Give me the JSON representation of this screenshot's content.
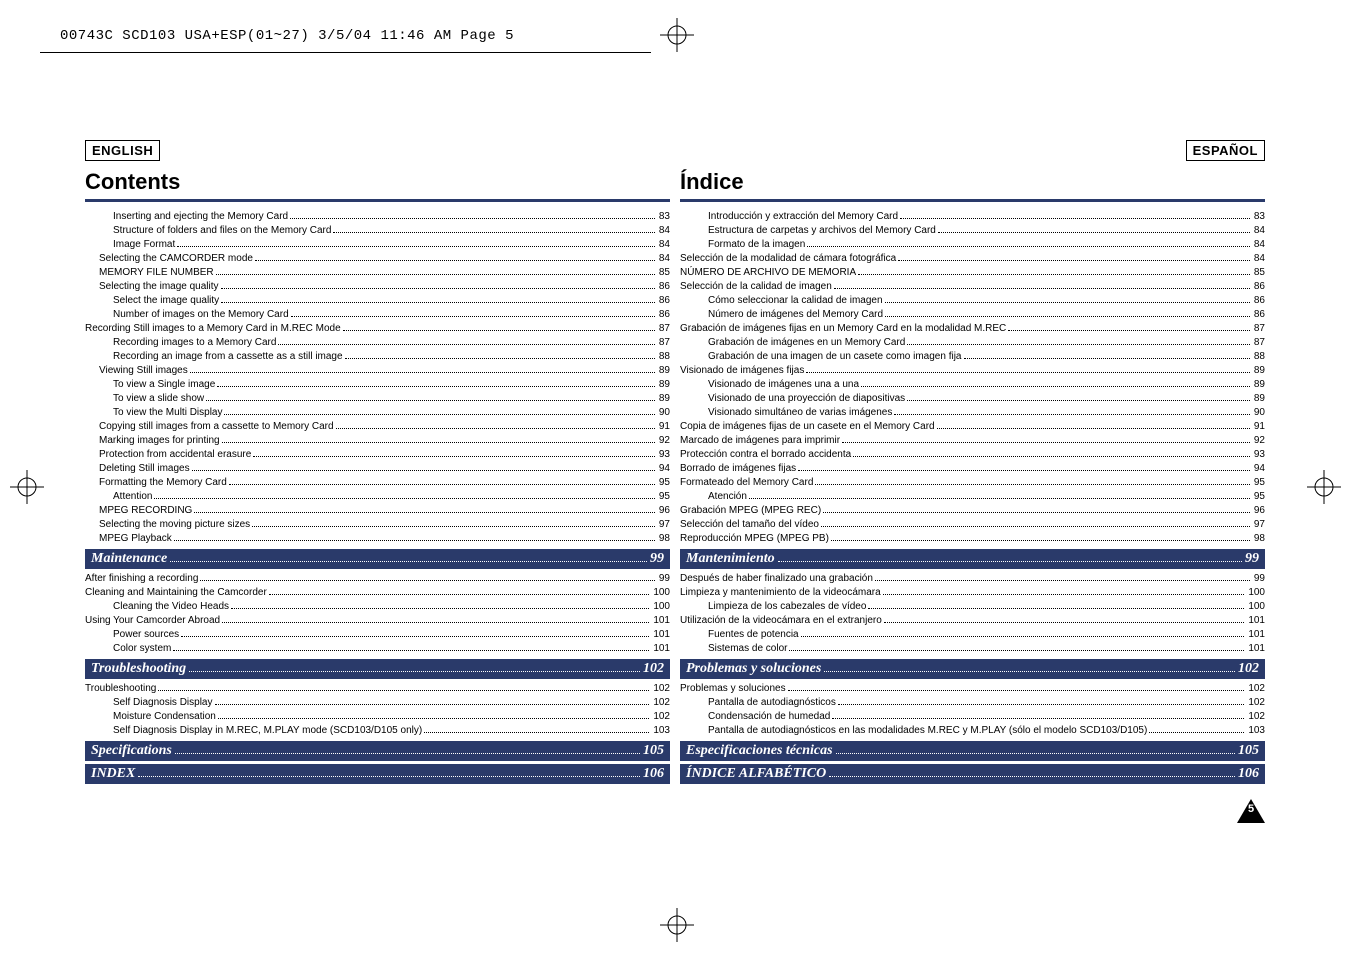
{
  "header_info": "00743C SCD103 USA+ESP(01~27)  3/5/04 11:46 AM  Page 5",
  "page_number": "5",
  "left": {
    "lang": "ENGLISH",
    "heading": "Contents",
    "entries": [
      {
        "l": "Inserting and ejecting the Memory Card",
        "p": "83",
        "i": 2
      },
      {
        "l": "Structure of folders and files on the Memory Card",
        "p": "84",
        "i": 2
      },
      {
        "l": "Image Format",
        "p": "84",
        "i": 2
      },
      {
        "l": "Selecting the CAMCORDER mode",
        "p": "84",
        "i": 1
      },
      {
        "l": "MEMORY FILE NUMBER",
        "p": "85",
        "i": 1
      },
      {
        "l": "Selecting the image quality",
        "p": "86",
        "i": 1
      },
      {
        "l": "Select the image quality",
        "p": "86",
        "i": 2
      },
      {
        "l": "Number of images on the Memory Card",
        "p": "86",
        "i": 2
      },
      {
        "l": "Recording Still images to a Memory Card in M.REC Mode",
        "p": "87",
        "i": 0
      },
      {
        "l": "Recording images to a Memory Card",
        "p": "87",
        "i": 2
      },
      {
        "l": "Recording an image from a cassette as a still image",
        "p": "88",
        "i": 2
      },
      {
        "l": "Viewing Still images",
        "p": "89",
        "i": 1
      },
      {
        "l": "To view a Single image",
        "p": "89",
        "i": 2
      },
      {
        "l": "To view a slide show",
        "p": "89",
        "i": 2
      },
      {
        "l": "To view the Multi Display",
        "p": "90",
        "i": 2
      },
      {
        "l": "Copying still images from a cassette to Memory Card",
        "p": "91",
        "i": 1
      },
      {
        "l": "Marking images for printing",
        "p": "92",
        "i": 1
      },
      {
        "l": "Protection from accidental erasure",
        "p": "93",
        "i": 1
      },
      {
        "l": "Deleting Still images",
        "p": "94",
        "i": 1
      },
      {
        "l": "Formatting the Memory Card",
        "p": "95",
        "i": 1
      },
      {
        "l": "Attention",
        "p": "95",
        "i": 2
      },
      {
        "l": "MPEG RECORDING",
        "p": "96",
        "i": 1
      },
      {
        "l": "Selecting the moving picture sizes",
        "p": "97",
        "i": 1
      },
      {
        "l": "MPEG Playback",
        "p": "98",
        "i": 1
      }
    ],
    "sections": [
      {
        "title": "Maintenance",
        "p": "99",
        "entries": [
          {
            "l": "After finishing a recording",
            "p": "99",
            "i": 0
          },
          {
            "l": "Cleaning and Maintaining the Camcorder",
            "p": "100",
            "i": 0
          },
          {
            "l": "Cleaning the Video Heads",
            "p": "100",
            "i": 2
          },
          {
            "l": "Using Your Camcorder Abroad",
            "p": "101",
            "i": 0
          },
          {
            "l": "Power sources",
            "p": "101",
            "i": 2
          },
          {
            "l": "Color system",
            "p": "101",
            "i": 2
          }
        ]
      },
      {
        "title": "Troubleshooting",
        "p": "102",
        "entries": [
          {
            "l": "Troubleshooting",
            "p": "102",
            "i": 0
          },
          {
            "l": "Self Diagnosis Display",
            "p": "102",
            "i": 2
          },
          {
            "l": "Moisture Condensation",
            "p": "102",
            "i": 2
          },
          {
            "l": "Self Diagnosis Display in M.REC, M.PLAY mode (SCD103/D105 only)",
            "p": "103",
            "i": 2
          }
        ]
      },
      {
        "title": "Specifications",
        "p": "105",
        "entries": []
      },
      {
        "title": "INDEX",
        "p": "106",
        "entries": []
      }
    ]
  },
  "right": {
    "lang": "ESPAÑOL",
    "heading": "Índice",
    "entries": [
      {
        "l": "Introducción y extracción del Memory Card",
        "p": "83",
        "i": 2
      },
      {
        "l": "Estructura de carpetas y archivos del Memory Card",
        "p": "84",
        "i": 2
      },
      {
        "l": "Formato de la imagen",
        "p": "84",
        "i": 2
      },
      {
        "l": "Selección de la modalidad de cámara fotográfica",
        "p": "84",
        "i": 0
      },
      {
        "l": "NÚMERO DE ARCHIVO DE MEMORIA",
        "p": "85",
        "i": 0
      },
      {
        "l": "Selección de la calidad de imagen",
        "p": "86",
        "i": 0
      },
      {
        "l": "Cómo seleccionar la calidad de imagen",
        "p": "86",
        "i": 2
      },
      {
        "l": "Número de imágenes del Memory Card",
        "p": "86",
        "i": 2
      },
      {
        "l": "Grabación de imágenes fijas en un Memory Card en la modalidad M.REC",
        "p": "87",
        "i": 0
      },
      {
        "l": "Grabación de imágenes en un Memory Card",
        "p": "87",
        "i": 2
      },
      {
        "l": "Grabación de una imagen de un casete como imagen fija",
        "p": "88",
        "i": 2
      },
      {
        "l": "Visionado de imágenes fijas",
        "p": "89",
        "i": 0
      },
      {
        "l": "Visionado de imágenes una a una",
        "p": "89",
        "i": 2
      },
      {
        "l": "Visionado de una proyección de diapositivas",
        "p": "89",
        "i": 2
      },
      {
        "l": "Visionado simultáneo de varias imágenes",
        "p": "90",
        "i": 2
      },
      {
        "l": "Copia de imágenes fijas de un casete en el Memory Card",
        "p": "91",
        "i": 0
      },
      {
        "l": "Marcado de imágenes para imprimir",
        "p": "92",
        "i": 0
      },
      {
        "l": "Protección contra el borrado accidenta",
        "p": "93",
        "i": 0
      },
      {
        "l": "Borrado de imágenes fijas",
        "p": "94",
        "i": 0
      },
      {
        "l": "Formateado del Memory Card",
        "p": "95",
        "i": 0
      },
      {
        "l": "Atención",
        "p": "95",
        "i": 2
      },
      {
        "l": "Grabación MPEG (MPEG REC)",
        "p": "96",
        "i": 0
      },
      {
        "l": "Selección del tamaño del vídeo",
        "p": "97",
        "i": 0
      },
      {
        "l": "Reproducción MPEG (MPEG PB)",
        "p": "98",
        "i": 0
      }
    ],
    "sections": [
      {
        "title": "Mantenimiento",
        "p": "99",
        "entries": [
          {
            "l": "Después de haber finalizado una grabación",
            "p": "99",
            "i": 0
          },
          {
            "l": "Limpieza y mantenimiento de la videocámara",
            "p": "100",
            "i": 0
          },
          {
            "l": "Limpieza de los cabezales de vídeo",
            "p": "100",
            "i": 2
          },
          {
            "l": "Utilización de la videocámara en el extranjero",
            "p": "101",
            "i": 0
          },
          {
            "l": "Fuentes de potencia",
            "p": "101",
            "i": 2
          },
          {
            "l": "Sistemas de color",
            "p": "101",
            "i": 2
          }
        ]
      },
      {
        "title": "Problemas y soluciones",
        "p": "102",
        "entries": [
          {
            "l": "Problemas y soluciones",
            "p": "102",
            "i": 0
          },
          {
            "l": "Pantalla de autodiagnósticos",
            "p": "102",
            "i": 2
          },
          {
            "l": "Condensación de humedad",
            "p": "102",
            "i": 2
          },
          {
            "l": "Pantalla de autodiagnósticos en las modalidades M.REC y M.PLAY (sólo el modelo SCD103/D105)",
            "p": "103",
            "i": 2
          }
        ]
      },
      {
        "title": "Especificaciones técnicas",
        "p": "105",
        "entries": []
      },
      {
        "title": "ÍNDICE ALFABÉTICO",
        "p": "106",
        "entries": []
      }
    ]
  }
}
